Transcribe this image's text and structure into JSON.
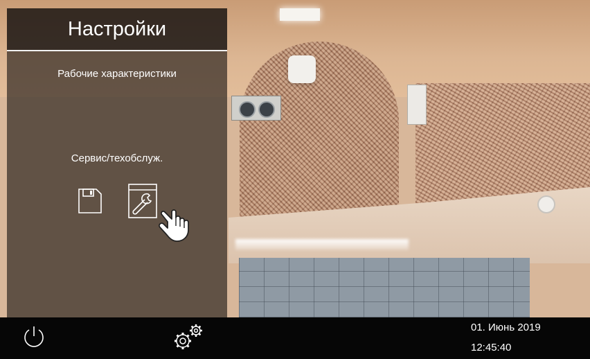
{
  "settings_panel": {
    "title": "Настройки",
    "items": [
      {
        "label": "Рабочие характеристики"
      },
      {
        "label": "Сервис/техобслуж."
      }
    ],
    "icons": [
      "floppy-disk-icon",
      "wrench-window-icon",
      "pointing-hand-icon"
    ]
  },
  "bottom_bar": {
    "icons": [
      "power-icon",
      "gears-icon"
    ],
    "date": "01. Июнь 2019",
    "time": "12:45:40"
  },
  "colors": {
    "bar_background": "#060606",
    "panel_overlay": "#181412",
    "text": "#ffffff"
  }
}
